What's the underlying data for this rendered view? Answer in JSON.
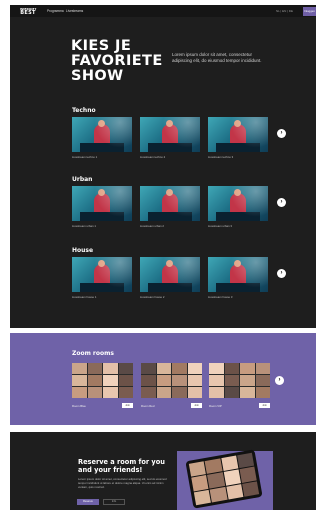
{
  "header": {
    "logo_small": "WIEKOMT",
    "logo_big": "BEST",
    "nav": [
      "Programma",
      "Livestreams"
    ],
    "language": "NL | EN | DE",
    "signin_label": "Inloggen"
  },
  "hero": {
    "title_lines": [
      "KIES JE",
      "FAVORIETE",
      "SHOW"
    ],
    "text": "Lorem ipsum dolor sit amet, consectetur adipiscing elit, do eiusmod tempor incididunt."
  },
  "categories": [
    {
      "title": "Techno",
      "captions": [
        "Livestream techno 1",
        "Livestream techno 2",
        "Livestream techno 3"
      ]
    },
    {
      "title": "Urban",
      "captions": [
        "Livestream urban 1",
        "Livestream urban 2",
        "Livestream urban 3"
      ]
    },
    {
      "title": "House",
      "captions": [
        "Livestream house 1",
        "Livestream house 2",
        "Livestream house 3"
      ]
    }
  ],
  "icons": {
    "arrow": "arrow-right-icon"
  },
  "zoom": {
    "title": "Zoom rooms",
    "rooms": [
      {
        "label": "Room Blue",
        "button": "Join"
      },
      {
        "label": "Room Red",
        "button": "Join"
      },
      {
        "label": "Room VIP",
        "button": "Join"
      }
    ]
  },
  "reserve": {
    "title": "Reserve a room for you and your friends!",
    "text": "Lorem ipsum dolor sit amet, consectetur adipiscing elit, sed do eiusmod tempor incididunt ut labore et dolore magna aliqua. Ut enim ad minim veniam, quis nostrud.",
    "primary_button": "Reserve",
    "secondary_button": "Info"
  },
  "colors": {
    "accent": "#6f62a8",
    "dark": "#1e1e1e"
  }
}
